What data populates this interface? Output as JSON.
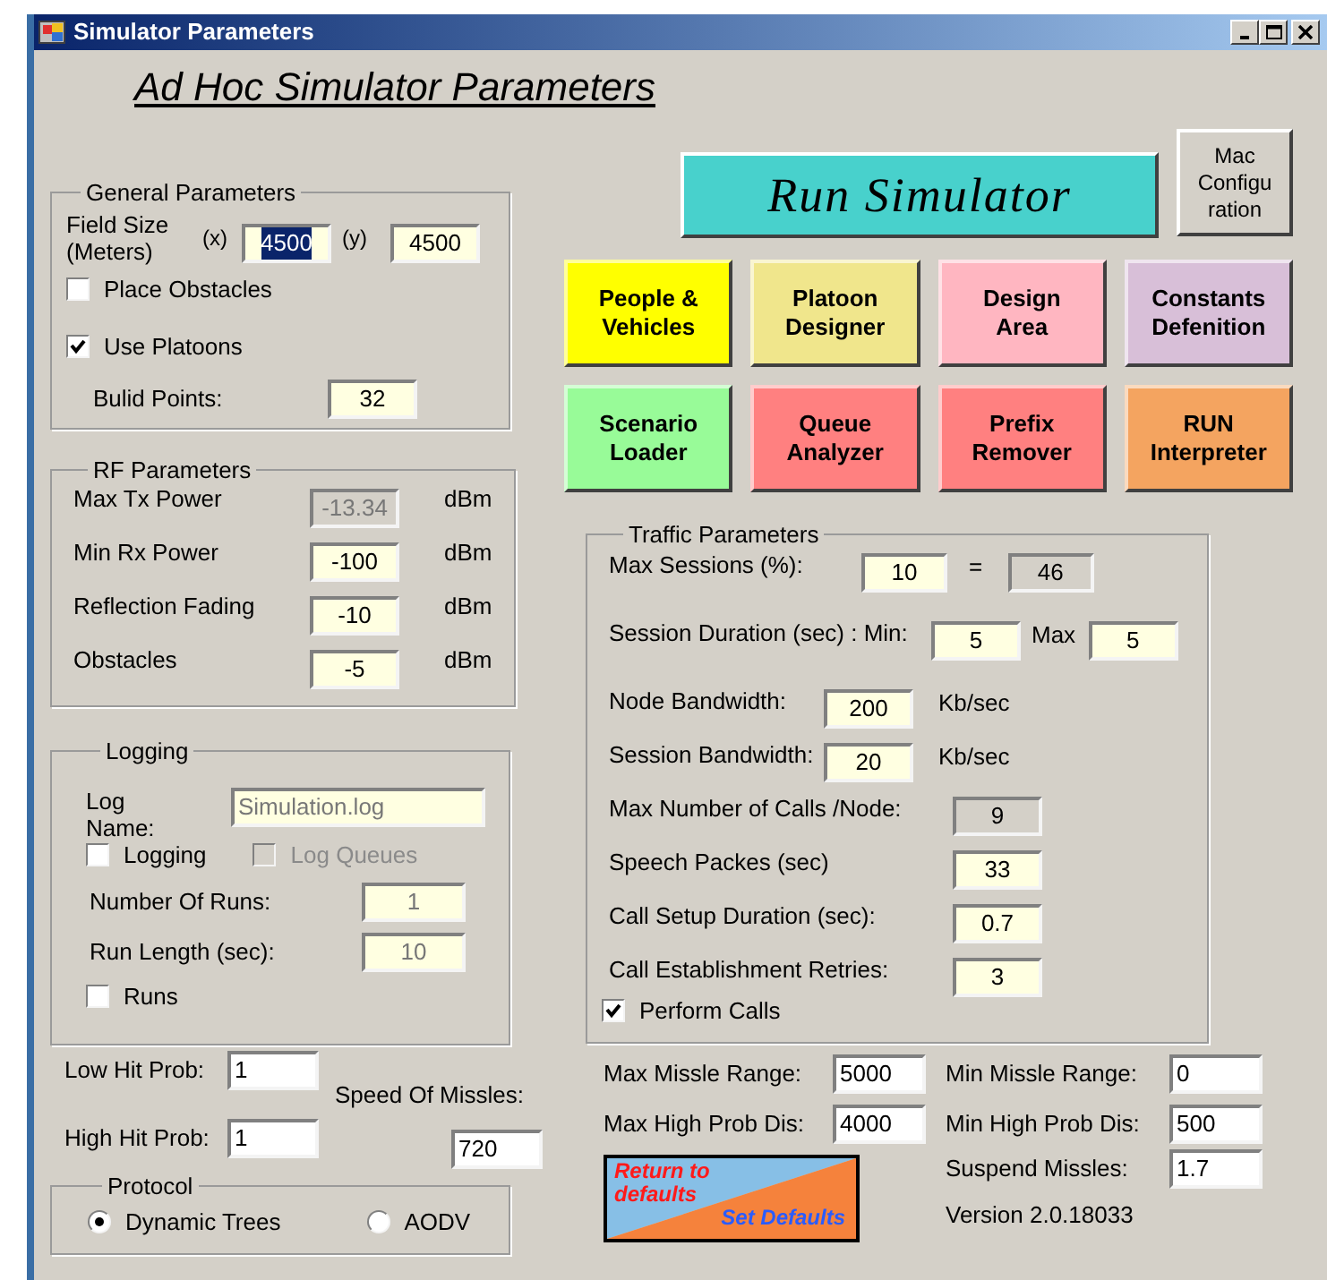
{
  "window": {
    "title": "Simulator Parameters"
  },
  "heading": "Ad Hoc Simulator Parameters",
  "general": {
    "title": "General Parameters",
    "field_size_label": "Field Size (Meters)",
    "x_label": "(x)",
    "x_value": "4500",
    "x_text_selected": true,
    "y_label": "(y)",
    "y_value": "4500",
    "checkboxes": [
      {
        "label": "Place Obstacles",
        "checked": false
      },
      {
        "label": "Use Platoons",
        "checked": true
      }
    ],
    "build_points": {
      "label": "Bulid Points:",
      "value": "32"
    }
  },
  "rf": {
    "title": "RF Parameters",
    "rows": [
      {
        "label": "Max Tx Power",
        "value": "-13.34",
        "unit": "dBm",
        "disabled": true
      },
      {
        "label": "Min Rx Power",
        "value": "-100",
        "unit": "dBm",
        "disabled": false
      },
      {
        "label": "Reflection Fading",
        "value": "-10",
        "unit": "dBm",
        "disabled": false
      },
      {
        "label": "Obstacles",
        "value": "-5",
        "unit": "dBm",
        "disabled": false
      }
    ]
  },
  "logging": {
    "title": "Logging",
    "log_name": {
      "label": "Log Name:",
      "value": "Simulation.log",
      "disabled": true
    },
    "checkboxes": [
      {
        "label": "Logging",
        "checked": false,
        "disabled": false
      },
      {
        "label": "Log Queues",
        "checked": false,
        "disabled": true
      }
    ],
    "fields": [
      {
        "label": "Number Of Runs:",
        "value": "1",
        "disabled": true
      },
      {
        "label": "Run Length (sec):",
        "value": "10",
        "disabled": true
      }
    ],
    "runs": {
      "label": "Runs",
      "checked": false
    }
  },
  "hits": {
    "low": {
      "label": "Low Hit Prob:",
      "value": "1"
    },
    "high": {
      "label": "High Hit Prob:",
      "value": "1"
    },
    "speed": {
      "label": "Speed Of Missles:",
      "value": "720"
    }
  },
  "protocol": {
    "title": "Protocol",
    "options": [
      {
        "label": "Dynamic Trees",
        "selected": true
      },
      {
        "label": "AODV",
        "selected": false
      }
    ]
  },
  "run_button": "Run Simulator",
  "mac_button": "Mac Configuration",
  "tool_buttons": [
    {
      "label": "People & Vehicles",
      "color": "#ffff00"
    },
    {
      "label": "Platoon Designer",
      "color": "#f0e68c"
    },
    {
      "label": "Design Area",
      "color": "#ffb6c1"
    },
    {
      "label": "Constants Defenition",
      "color": "#d8bfd8"
    },
    {
      "label": "Scenario Loader",
      "color": "#98fb98"
    },
    {
      "label": "Queue Analyzer",
      "color": "#ff8080"
    },
    {
      "label": "Prefix Remover",
      "color": "#ff8080"
    },
    {
      "label": "RUN Interpreter",
      "color": "#f4a460"
    }
  ],
  "traffic": {
    "title": "Traffic Parameters",
    "rows": [
      {
        "items": [
          {
            "kind": "label",
            "text": "Max Sessions (%):"
          },
          {
            "kind": "field",
            "value": "10"
          },
          {
            "kind": "text",
            "text": "="
          },
          {
            "kind": "readonly",
            "value": "46"
          }
        ]
      },
      {
        "items": [
          {
            "kind": "label",
            "text": "Session Duration (sec) : Min:"
          },
          {
            "kind": "field",
            "value": "5"
          },
          {
            "kind": "text",
            "text": "Max"
          },
          {
            "kind": "field",
            "value": "5"
          }
        ]
      },
      {
        "items": [
          {
            "kind": "label",
            "text": "Node Bandwidth:"
          },
          {
            "kind": "field",
            "value": "200"
          },
          {
            "kind": "text",
            "text": "Kb/sec"
          }
        ]
      },
      {
        "items": [
          {
            "kind": "label",
            "text": "Session Bandwidth:"
          },
          {
            "kind": "field",
            "value": "20"
          },
          {
            "kind": "text",
            "text": "Kb/sec"
          }
        ]
      },
      {
        "items": [
          {
            "kind": "label",
            "text": "Max Number of Calls /Node:"
          },
          {
            "kind": "readonly",
            "value": "9"
          }
        ]
      },
      {
        "items": [
          {
            "kind": "label",
            "text": "Speech Packes (sec)"
          },
          {
            "kind": "field",
            "value": "33"
          }
        ]
      },
      {
        "items": [
          {
            "kind": "label",
            "text": "Call Setup Duration (sec):"
          },
          {
            "kind": "field",
            "value": "0.7"
          }
        ]
      },
      {
        "items": [
          {
            "kind": "label",
            "text": "Call Establishment Retries:"
          },
          {
            "kind": "field",
            "value": "3"
          }
        ]
      }
    ],
    "perform_calls": {
      "label": "Perform Calls",
      "checked": true
    }
  },
  "missiles": {
    "fields": [
      {
        "label": "Max Missle Range:",
        "value": "5000"
      },
      {
        "label": "Min Missle Range:",
        "value": "0"
      },
      {
        "label": "Max High Prob Dis:",
        "value": "4000"
      },
      {
        "label": "Min High Prob Dis:",
        "value": "500"
      }
    ],
    "suspend": {
      "label": "Suspend Missles:",
      "value": "1.7"
    }
  },
  "defaults_button": {
    "top": "Return to defaults",
    "bottom": "Set Defaults"
  },
  "version": "Version 2.0.18033"
}
